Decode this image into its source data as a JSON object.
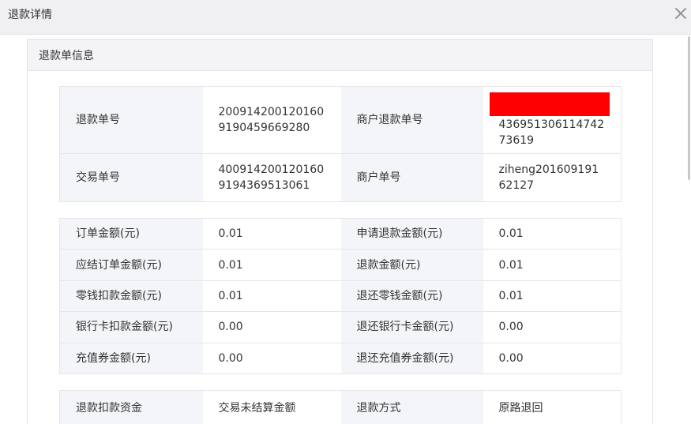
{
  "dialog": {
    "title": "退款详情"
  },
  "panel": {
    "title": "退款单信息"
  },
  "basic": {
    "refund_no_label": "退款单号",
    "refund_no_value": "2009142001201609190459669280",
    "merchant_refund_no_label": "商户退款单号",
    "merchant_refund_no_value": "43695130611474273619",
    "trade_no_label": "交易单号",
    "trade_no_value": "4009142001201609194369513061",
    "merchant_order_no_label": "商户单号",
    "merchant_order_no_value": "ziheng20160919162127"
  },
  "amounts": [
    {
      "label_left": "订单金额(元)",
      "value_left": "0.01",
      "label_right": "申请退款金额(元)",
      "value_right": "0.01"
    },
    {
      "label_left": "应结订单金额(元)",
      "value_left": "0.01",
      "label_right": "退款金额(元)",
      "value_right": "0.01"
    },
    {
      "label_left": "零钱扣款金额(元)",
      "value_left": "0.01",
      "label_right": "退还零钱金额(元)",
      "value_right": "0.01"
    },
    {
      "label_left": "银行卡扣款金额(元)",
      "value_left": "0.00",
      "label_right": "退还银行卡金额(元)",
      "value_right": "0.00"
    },
    {
      "label_left": "充值券金额(元)",
      "value_left": "0.00",
      "label_right": "退还充值券金额(元)",
      "value_right": "0.00"
    }
  ],
  "method": {
    "fund_label": "退款扣款资金",
    "fund_value": "交易未结算金额",
    "method_label": "退款方式",
    "method_value": "原路退回"
  },
  "colors": {
    "redaction": "#ff0000",
    "label_bg": "#f4f5f8",
    "header_bg": "#f0f0f3"
  }
}
